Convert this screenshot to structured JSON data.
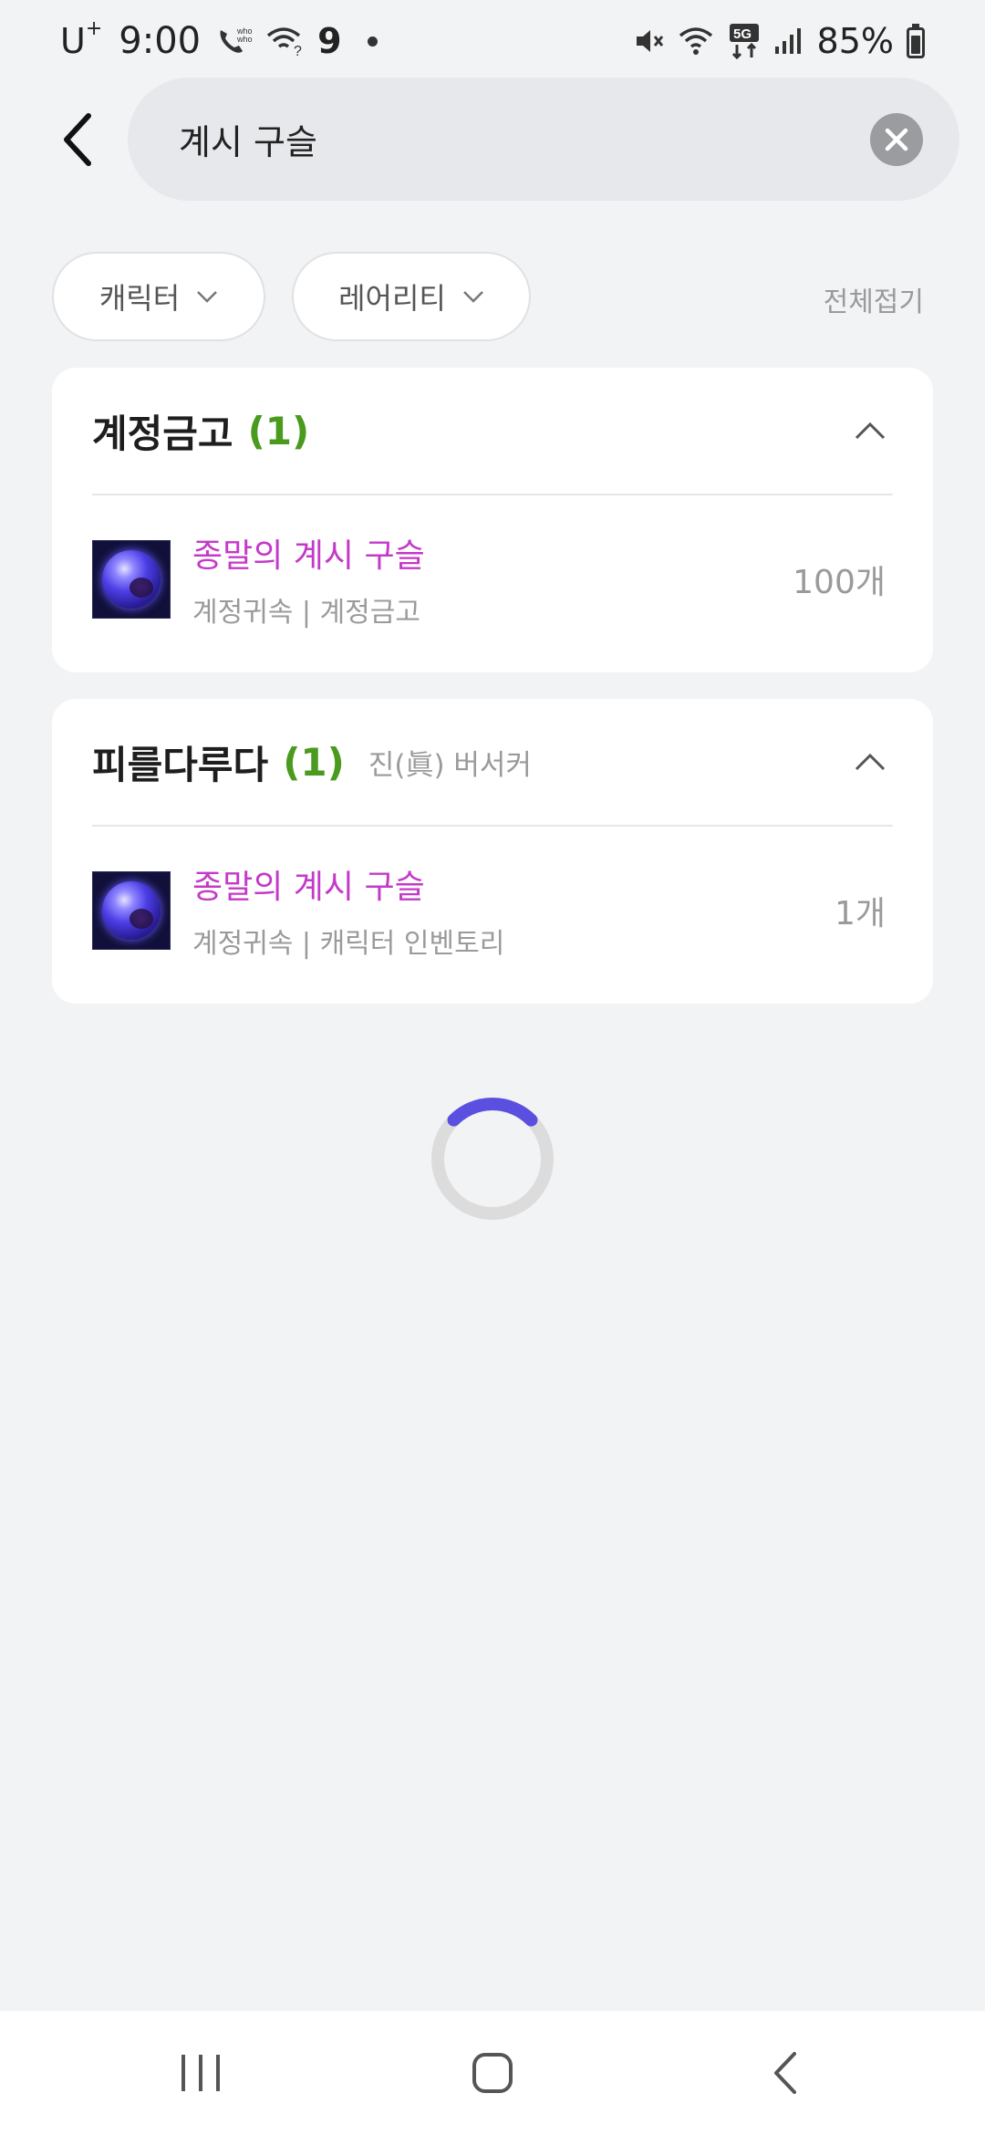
{
  "status_bar": {
    "carrier": "U",
    "carrier_sup": "+",
    "time": "9:00",
    "badge_number": "9",
    "battery": "85%",
    "network": "5G",
    "icons": [
      "whowho-call-icon",
      "wifi-question-icon",
      "mute-icon",
      "wifi-icon",
      "signal-icon",
      "battery-icon"
    ]
  },
  "search": {
    "query": "계시 구슬",
    "back_icon": "chevron-left-icon",
    "clear_icon": "close-circle-icon"
  },
  "filters": {
    "character_label": "캐릭터",
    "rarity_label": "레어리티",
    "collapse_all_label": "전체접기"
  },
  "groups": [
    {
      "title": "계정금고",
      "count": "(1)",
      "subtitle": "",
      "items": [
        {
          "name": "종말의 계시 구슬",
          "meta": "계정귀속 | 계정금고",
          "qty": "100개"
        }
      ]
    },
    {
      "title": "피를다루다",
      "count": "(1)",
      "subtitle": "진(眞) 버서커",
      "items": [
        {
          "name": "종말의 계시 구슬",
          "meta": "계정귀속 | 캐릭터 인벤토리",
          "qty": "1개"
        }
      ]
    }
  ],
  "colors": {
    "accent_count": "#4a9a1e",
    "item_name": "#c43ac8",
    "spinner": "#5b4fe0",
    "background": "#f2f3f5"
  },
  "loading": {
    "progress": 0.25
  }
}
